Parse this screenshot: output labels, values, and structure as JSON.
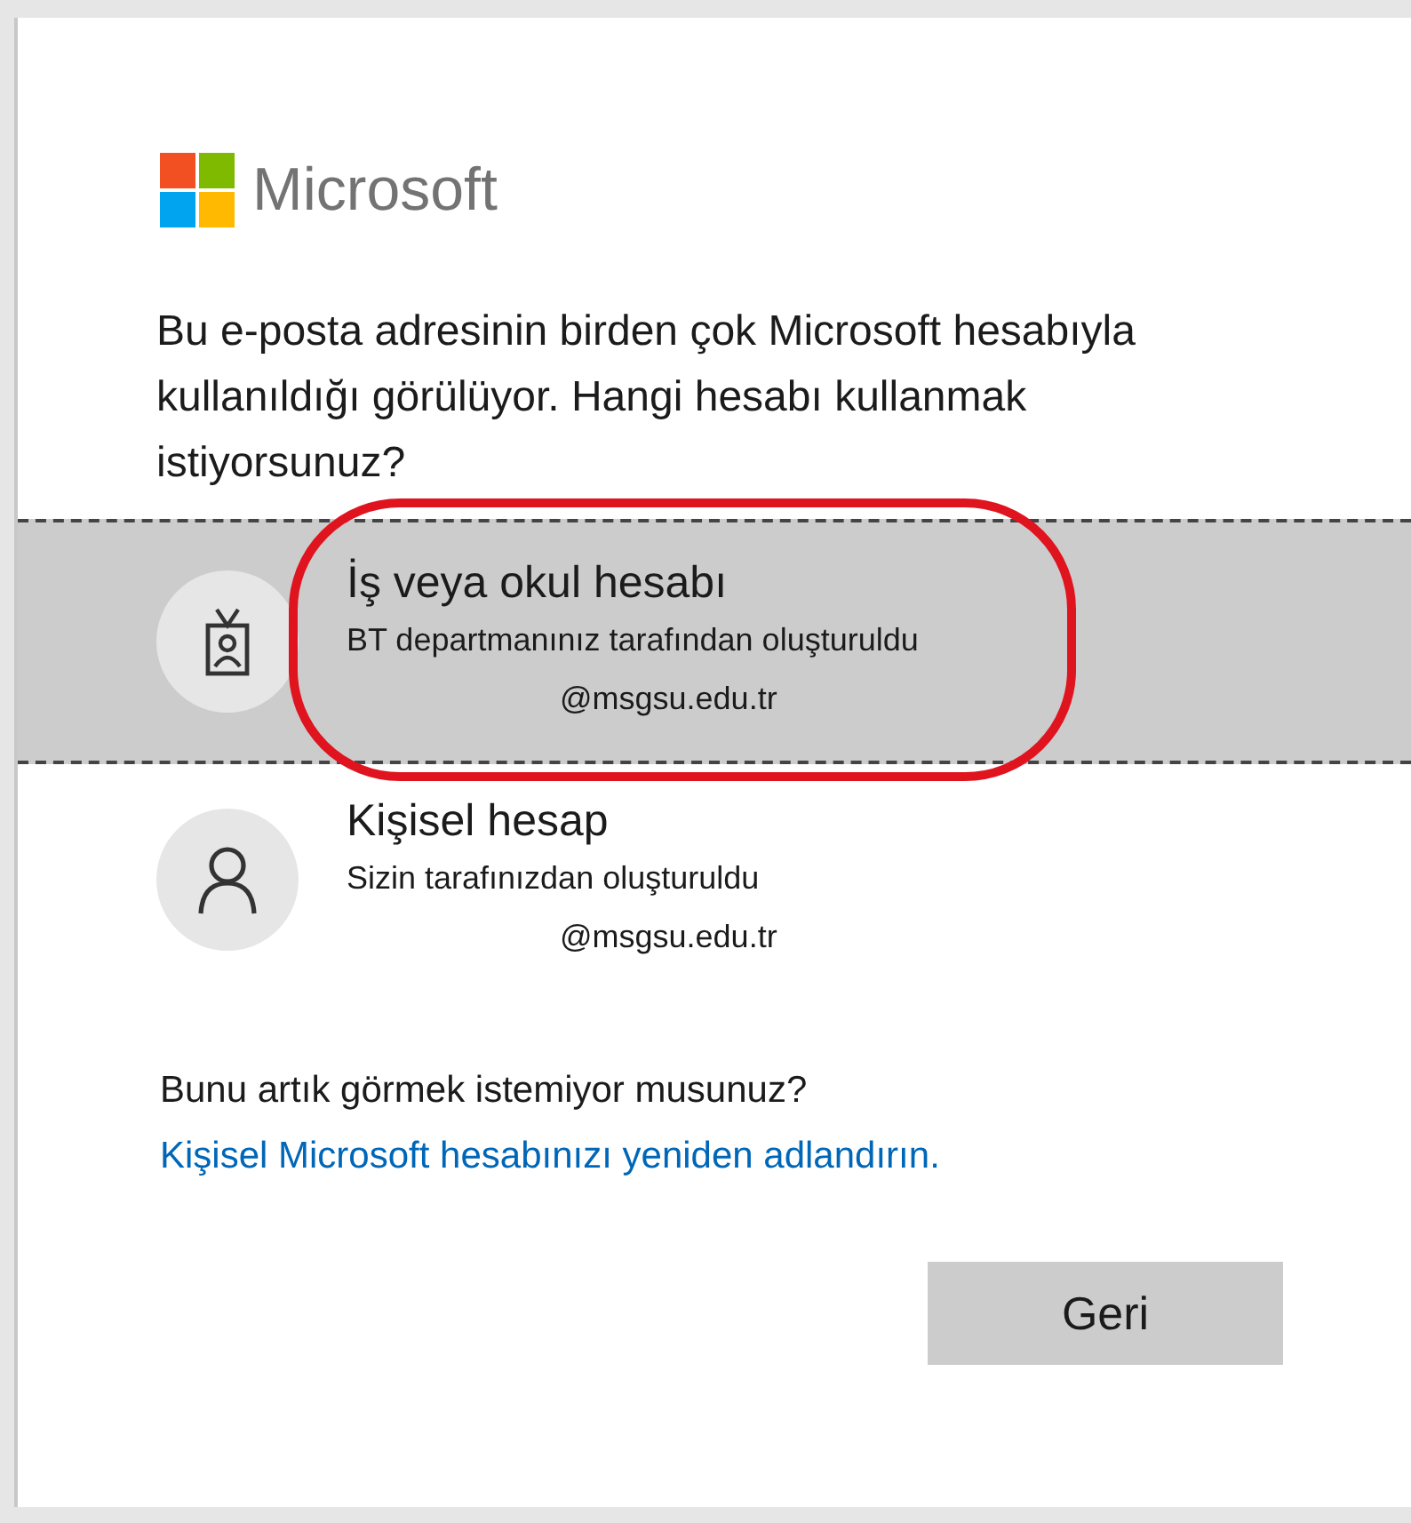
{
  "brand": {
    "name": "Microsoft"
  },
  "prompt": "Bu e-posta adresinin birden çok Microsoft hesabıyla kullanıldığı görülüyor. Hangi hesabı kullanmak istiyorsunuz?",
  "accounts": [
    {
      "kind": "work",
      "title": "İş veya okul hesabı",
      "subtitle": "BT departmanınız tarafından oluşturuldu",
      "email": "@msgsu.edu.tr",
      "selected": true
    },
    {
      "kind": "personal",
      "title": "Kişisel hesap",
      "subtitle": "Sizin tarafınızdan oluşturuldu",
      "email": "@msgsu.edu.tr",
      "selected": false
    }
  ],
  "footer": {
    "text": "Bunu artık görmek istemiyor musunuz?",
    "link": "Kişisel Microsoft hesabınızı yeniden adlandırın."
  },
  "buttons": [
    {
      "label": "Geri"
    }
  ]
}
